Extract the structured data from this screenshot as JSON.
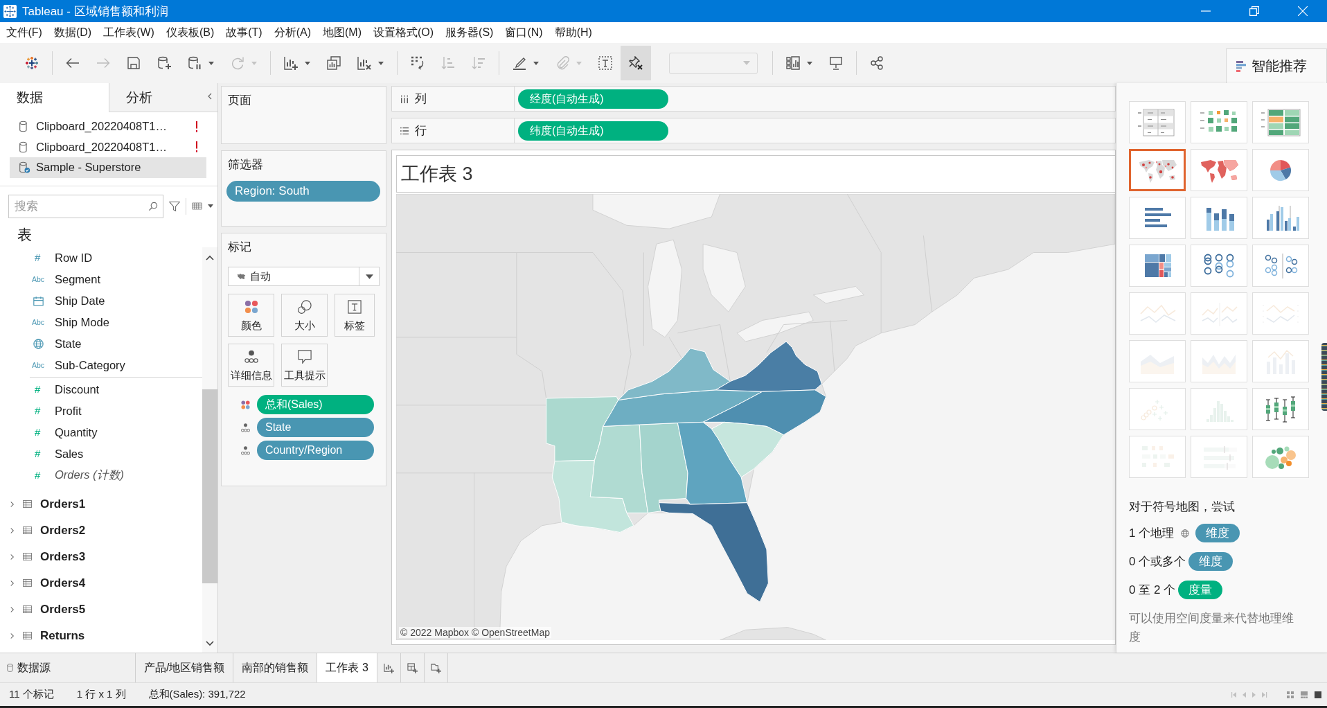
{
  "window": {
    "title": "Tableau - 区域销售额和利润"
  },
  "menu": [
    "文件(F)",
    "数据(D)",
    "工作表(W)",
    "仪表板(B)",
    "故事(T)",
    "分析(A)",
    "地图(M)",
    "设置格式(O)",
    "服务器(S)",
    "窗口(N)",
    "帮助(H)"
  ],
  "toolbar": {
    "groups": [
      {
        "tools": [
          {
            "kind": "logo",
            "disabled": false,
            "pressed": false,
            "caret": false
          }
        ]
      },
      {
        "tools": [
          {
            "kind": "back",
            "disabled": false,
            "pressed": false,
            "caret": false
          },
          {
            "kind": "forward",
            "disabled": true,
            "pressed": false,
            "caret": false
          },
          {
            "kind": "save",
            "disabled": false,
            "pressed": false,
            "caret": false
          },
          {
            "kind": "new-data-source",
            "disabled": false,
            "pressed": false,
            "caret": false
          },
          {
            "kind": "pause-updates",
            "disabled": false,
            "pressed": false,
            "caret": true
          },
          {
            "kind": "refresh",
            "disabled": true,
            "pressed": false,
            "caret": true
          }
        ]
      },
      {
        "tools": [
          {
            "kind": "new-worksheet",
            "disabled": false,
            "pressed": false,
            "caret": true
          },
          {
            "kind": "duplicate",
            "disabled": false,
            "pressed": false,
            "caret": false
          },
          {
            "kind": "clear-sheet",
            "disabled": false,
            "pressed": false,
            "caret": true
          }
        ]
      },
      {
        "tools": [
          {
            "kind": "swap",
            "disabled": false,
            "pressed": false,
            "caret": false
          },
          {
            "kind": "sort-ascending",
            "disabled": true,
            "pressed": false,
            "caret": false
          },
          {
            "kind": "sort-descending",
            "disabled": true,
            "pressed": false,
            "caret": false
          }
        ]
      },
      {
        "tools": [
          {
            "kind": "highlight",
            "disabled": false,
            "pressed": false,
            "caret": true
          },
          {
            "kind": "group",
            "disabled": true,
            "pressed": false,
            "caret": true
          },
          {
            "kind": "labels",
            "disabled": false,
            "pressed": false,
            "caret": false
          },
          {
            "kind": "fix-axes",
            "disabled": false,
            "pressed": true,
            "caret": false
          },
          {
            "kind": "fit-menu",
            "disabled": true,
            "pressed": false,
            "caret": false
          }
        ]
      },
      {
        "tools": [
          {
            "kind": "show-cards",
            "disabled": false,
            "pressed": false,
            "caret": true
          },
          {
            "kind": "presentation",
            "disabled": false,
            "pressed": false,
            "caret": false
          }
        ]
      },
      {
        "tools": [
          {
            "kind": "share",
            "disabled": false,
            "pressed": false,
            "caret": false
          }
        ]
      }
    ]
  },
  "data_pane": {
    "tabs": [
      {
        "label": "数据",
        "selected": true
      },
      {
        "label": "分析",
        "selected": false
      }
    ],
    "sources": [
      {
        "name": "Clipboard_20220408T1…",
        "kind": "warning",
        "selected": false
      },
      {
        "name": "Clipboard_20220408T1…",
        "kind": "warning",
        "selected": false
      },
      {
        "name": "Sample - Superstore",
        "kind": "connected",
        "selected": true
      }
    ],
    "search": {
      "placeholder": "搜索"
    },
    "heading": "表",
    "fields": [
      {
        "name": "Row ID",
        "kind": "number",
        "type_label": "#",
        "measure": false,
        "italic": false
      },
      {
        "name": "Segment",
        "kind": "string",
        "type_label": "Abc",
        "measure": false,
        "italic": false
      },
      {
        "name": "Ship Date",
        "kind": "date",
        "measure": false,
        "italic": false
      },
      {
        "name": "Ship Mode",
        "kind": "string",
        "type_label": "Abc",
        "measure": false,
        "italic": false
      },
      {
        "name": "State",
        "kind": "geo",
        "measure": false,
        "italic": false
      },
      {
        "name": "Sub-Category",
        "kind": "string",
        "type_label": "Abc",
        "measure": false,
        "italic": false
      },
      {
        "name": "Discount",
        "kind": "number",
        "type_label": "#",
        "measure": true,
        "italic": false
      },
      {
        "name": "Profit",
        "kind": "number",
        "type_label": "#",
        "measure": true,
        "italic": false
      },
      {
        "name": "Quantity",
        "kind": "number",
        "type_label": "#",
        "measure": true,
        "italic": false
      },
      {
        "name": "Sales",
        "kind": "number",
        "type_label": "#",
        "measure": true,
        "italic": false
      },
      {
        "name": "Orders (计数)",
        "kind": "number",
        "type_label": "#",
        "measure": true,
        "italic": true
      }
    ],
    "tables": [
      {
        "name": "Orders1",
        "expanded": false
      },
      {
        "name": "Orders2",
        "expanded": false
      },
      {
        "name": "Orders3",
        "expanded": false
      },
      {
        "name": "Orders4",
        "expanded": false
      },
      {
        "name": "Orders5",
        "expanded": false
      },
      {
        "name": "Returns",
        "expanded": false
      }
    ]
  },
  "pages": {
    "title": "页面"
  },
  "filters": {
    "title": "筛选器",
    "pills": [
      {
        "name": "Region: South",
        "measure": false
      }
    ]
  },
  "marks": {
    "title": "标记",
    "mark_type": "自动",
    "buttons": [
      {
        "kind": "color",
        "label": "颜色"
      },
      {
        "kind": "size",
        "label": "大小"
      },
      {
        "kind": "label",
        "label": "标签"
      },
      {
        "kind": "detail",
        "label": "详细信息"
      },
      {
        "kind": "tooltip",
        "label": "工具提示"
      }
    ],
    "fields": [
      {
        "name": "总和(Sales)",
        "kind": "color",
        "measure": true
      },
      {
        "name": "State",
        "kind": "detail",
        "measure": false
      },
      {
        "name": "Country/Region",
        "kind": "detail",
        "measure": false
      }
    ]
  },
  "shelves": [
    {
      "kind": "columns",
      "label": "列",
      "pills": [
        {
          "name": "经度(自动生成)",
          "measure": true
        }
      ]
    },
    {
      "kind": "rows",
      "label": "行",
      "pills": [
        {
          "name": "纬度(自动生成)",
          "measure": true
        }
      ]
    }
  ],
  "view": {
    "title": "工作表 3",
    "map": {
      "regions": [
        {
          "color": "#abd9cf"
        },
        {
          "color": "#c2e5dc"
        },
        {
          "color": "#b0dbd2"
        },
        {
          "color": "#a4d4cd"
        },
        {
          "color": "#6eaec2"
        },
        {
          "color": "#80b9c8"
        },
        {
          "color": "#4a7ea5"
        },
        {
          "color": "#4f8fb0"
        },
        {
          "color": "#c6e6dd"
        },
        {
          "color": "#5fa4bf"
        },
        {
          "color": "#3f6f96"
        }
      ],
      "attribution": "© 2022 Mapbox © OpenStreetMap"
    }
  },
  "show_me": {
    "title": "智能推荐",
    "charts": [
      {
        "kind": "text-table",
        "selected": false,
        "disabled": false
      },
      {
        "kind": "heat-map",
        "selected": false,
        "disabled": false
      },
      {
        "kind": "highlight-table",
        "selected": false,
        "disabled": false
      },
      {
        "kind": "symbol-map",
        "selected": true,
        "disabled": false
      },
      {
        "kind": "filled-map",
        "selected": false,
        "disabled": false
      },
      {
        "kind": "pie",
        "selected": false,
        "disabled": false
      },
      {
        "kind": "horizontal-bars",
        "selected": false,
        "disabled": false
      },
      {
        "kind": "stacked-bars",
        "selected": false,
        "disabled": false
      },
      {
        "kind": "side-by-side-bars",
        "selected": false,
        "disabled": false
      },
      {
        "kind": "treemap",
        "selected": false,
        "disabled": false
      },
      {
        "kind": "circle-views",
        "selected": false,
        "disabled": false
      },
      {
        "kind": "side-by-side-circles",
        "selected": false,
        "disabled": false
      },
      {
        "kind": "lines-continuous",
        "selected": false,
        "disabled": true
      },
      {
        "kind": "lines-discrete",
        "selected": false,
        "disabled": true
      },
      {
        "kind": "dual-lines",
        "selected": false,
        "disabled": true
      },
      {
        "kind": "area-continuous",
        "selected": false,
        "disabled": true
      },
      {
        "kind": "area-discrete",
        "selected": false,
        "disabled": true
      },
      {
        "kind": "dual-combination",
        "selected": false,
        "disabled": true
      },
      {
        "kind": "scatter-plot",
        "selected": false,
        "disabled": true
      },
      {
        "kind": "histogram",
        "selected": false,
        "disabled": true
      },
      {
        "kind": "box-plot",
        "selected": false,
        "disabled": false
      },
      {
        "kind": "gantt",
        "selected": false,
        "disabled": true
      },
      {
        "kind": "bullet-graph",
        "selected": false,
        "disabled": true
      },
      {
        "kind": "packed-bubbles",
        "selected": false,
        "disabled": false
      }
    ],
    "hint": "对于符号地图，尝试",
    "requirements": [
      {
        "text": "1 个地理",
        "globe": true,
        "pill": "维度",
        "measure": false
      },
      {
        "text": "0 个或多个",
        "globe": false,
        "pill": "维度",
        "measure": false
      },
      {
        "text": "0 至 2 个",
        "globe": false,
        "pill": "度量",
        "measure": true
      }
    ],
    "note": "可以使用空间度量来代替地理维度"
  },
  "sheet_tabs": [
    {
      "label": "数据源",
      "kind": "data-source",
      "selected": false
    },
    {
      "label": "产品/地区销售额",
      "kind": "sheet",
      "selected": false
    },
    {
      "label": "南部的销售额",
      "kind": "sheet",
      "selected": false
    },
    {
      "label": "工作表 3",
      "kind": "sheet",
      "selected": true
    }
  ],
  "new_tab_buttons": [
    {
      "kind": "new-sheet"
    },
    {
      "kind": "new-dashboard"
    },
    {
      "kind": "new-story"
    }
  ],
  "status_bar": [
    "11 个标记",
    "1 行 x 1 列",
    "总和(Sales): 391,722"
  ]
}
